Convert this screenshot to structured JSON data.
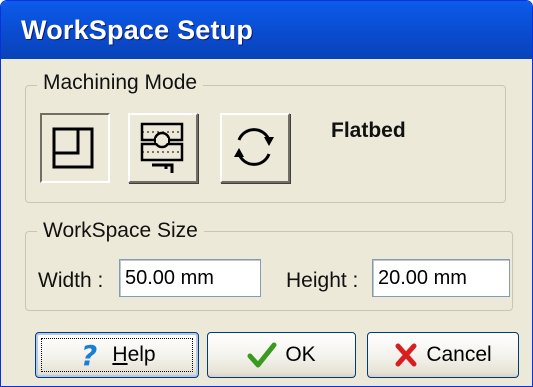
{
  "window": {
    "title": "WorkSpace Setup"
  },
  "machining_mode": {
    "group_label": "Machining Mode",
    "selected_mode": "Flatbed",
    "buttons": [
      {
        "name": "flatbed",
        "icon": "flatbed-icon",
        "pressed": true
      },
      {
        "name": "clamp",
        "icon": "clamp-fixture-icon",
        "pressed": false
      },
      {
        "name": "rotary",
        "icon": "rotary-icon",
        "pressed": false
      }
    ]
  },
  "workspace_size": {
    "group_label": "WorkSpace Size",
    "width_label": "Width :",
    "width_value": "50.00 mm",
    "height_label": "Height :",
    "height_value": "20.00 mm"
  },
  "buttons": {
    "help": {
      "label": "Help",
      "icon": "help-question-icon",
      "icon_color": "#1a7fd4"
    },
    "ok": {
      "label": "OK",
      "icon": "checkmark-icon",
      "icon_color": "#3a9a1f"
    },
    "cancel": {
      "label": "Cancel",
      "icon": "cancel-x-icon",
      "icon_color": "#d81e1e"
    }
  },
  "colors": {
    "titlebar": "#0a50d8",
    "dialog_face": "#ece9d8",
    "field_border": "#7f9db9"
  }
}
